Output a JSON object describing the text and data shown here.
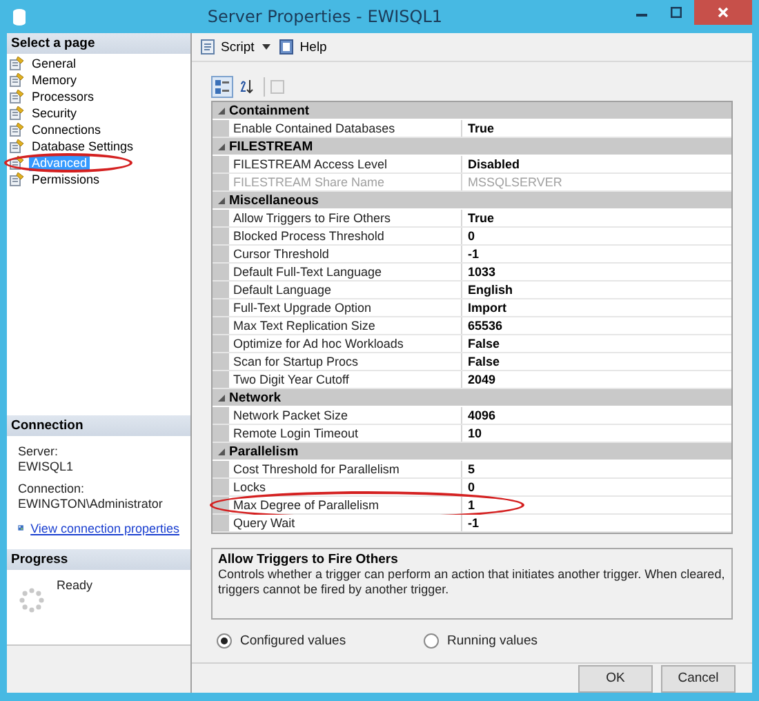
{
  "window": {
    "title": "Server Properties - EWISQL1"
  },
  "sidebar": {
    "heading": "Select a page",
    "pages": [
      {
        "label": "General",
        "selected": false,
        "annotated": false
      },
      {
        "label": "Memory",
        "selected": false,
        "annotated": false
      },
      {
        "label": "Processors",
        "selected": false,
        "annotated": false
      },
      {
        "label": "Security",
        "selected": false,
        "annotated": false
      },
      {
        "label": "Connections",
        "selected": false,
        "annotated": false
      },
      {
        "label": "Database Settings",
        "selected": false,
        "annotated": false
      },
      {
        "label": "Advanced",
        "selected": true,
        "annotated": true
      },
      {
        "label": "Permissions",
        "selected": false,
        "annotated": false
      }
    ]
  },
  "connection": {
    "heading": "Connection",
    "server_label": "Server:",
    "server": "EWISQL1",
    "connection_label": "Connection:",
    "connection": "EWINGTON\\Administrator",
    "link": "View connection properties"
  },
  "progress": {
    "heading": "Progress",
    "status": "Ready"
  },
  "toolbar": {
    "script": "Script",
    "help": "Help"
  },
  "grid_toolbar": [
    {
      "kind": "categorized",
      "selected": true
    },
    {
      "kind": "alphabetical",
      "selected": false
    }
  ],
  "categories": [
    {
      "name": "Containment",
      "expanded": true,
      "properties": [
        {
          "name": "Enable Contained Databases",
          "value": "True",
          "disabled": false,
          "annotated": false
        }
      ]
    },
    {
      "name": "FILESTREAM",
      "expanded": true,
      "properties": [
        {
          "name": "FILESTREAM Access Level",
          "value": "Disabled",
          "disabled": false,
          "annotated": false
        },
        {
          "name": "FILESTREAM Share Name",
          "value": "MSSQLSERVER",
          "disabled": true,
          "annotated": false
        }
      ]
    },
    {
      "name": "Miscellaneous",
      "expanded": true,
      "properties": [
        {
          "name": "Allow Triggers to Fire Others",
          "value": "True",
          "disabled": false,
          "annotated": false
        },
        {
          "name": "Blocked Process Threshold",
          "value": "0",
          "disabled": false,
          "annotated": false
        },
        {
          "name": "Cursor Threshold",
          "value": "-1",
          "disabled": false,
          "annotated": false
        },
        {
          "name": "Default Full-Text Language",
          "value": "1033",
          "disabled": false,
          "annotated": false
        },
        {
          "name": "Default Language",
          "value": "English",
          "disabled": false,
          "annotated": false
        },
        {
          "name": "Full-Text Upgrade Option",
          "value": "Import",
          "disabled": false,
          "annotated": false
        },
        {
          "name": "Max Text Replication Size",
          "value": "65536",
          "disabled": false,
          "annotated": false
        },
        {
          "name": "Optimize for Ad hoc Workloads",
          "value": "False",
          "disabled": false,
          "annotated": false
        },
        {
          "name": "Scan for Startup Procs",
          "value": "False",
          "disabled": false,
          "annotated": false
        },
        {
          "name": "Two Digit Year Cutoff",
          "value": "2049",
          "disabled": false,
          "annotated": false
        }
      ]
    },
    {
      "name": "Network",
      "expanded": true,
      "properties": [
        {
          "name": "Network Packet Size",
          "value": "4096",
          "disabled": false,
          "annotated": false
        },
        {
          "name": "Remote Login Timeout",
          "value": "10",
          "disabled": false,
          "annotated": false
        }
      ]
    },
    {
      "name": "Parallelism",
      "expanded": true,
      "properties": [
        {
          "name": "Cost Threshold for Parallelism",
          "value": "5",
          "disabled": false,
          "annotated": false
        },
        {
          "name": "Locks",
          "value": "0",
          "disabled": false,
          "annotated": false
        },
        {
          "name": "Max Degree of Parallelism",
          "value": "1",
          "disabled": false,
          "annotated": true
        },
        {
          "name": "Query Wait",
          "value": "-1",
          "disabled": false,
          "annotated": false
        }
      ]
    }
  ],
  "description": {
    "title": "Allow Triggers to Fire Others",
    "text": "Controls whether a trigger can perform an action that initiates another trigger. When cleared, triggers cannot be fired by another trigger."
  },
  "view_options": [
    {
      "label": "Configured values",
      "selected": true
    },
    {
      "label": "Running values",
      "selected": false
    }
  ],
  "buttons": [
    {
      "label": "OK"
    },
    {
      "label": "Cancel"
    }
  ]
}
